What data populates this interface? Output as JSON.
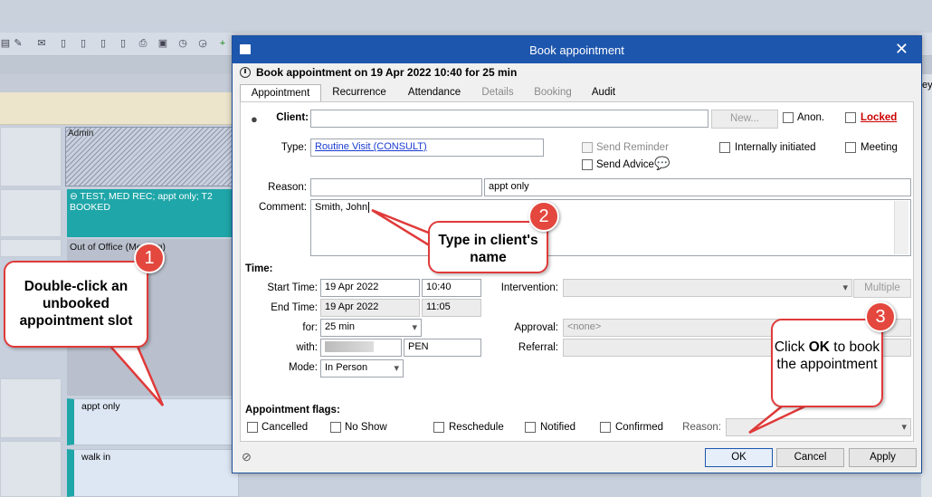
{
  "background": {
    "admin_label": "Admin",
    "teal_slot": "TEST, MED REC; appt only; T2 BOOKED",
    "ooo_slot": "Out of Office (Meeting)",
    "slot1": "appt only",
    "slot2": "walk in",
    "edge_text": "ey",
    "toolbar_icons": [
      "clipboard-icon",
      "tools-icon",
      "envelope-icon",
      "doc-icon",
      "doc-icon",
      "doc-icon",
      "doc-icon",
      "printer-icon",
      "sc-icon",
      "clock-icon",
      "clock-check-icon",
      "add-icon"
    ]
  },
  "dialog": {
    "title": "Book appointment",
    "heading": "Book appointment on 19 Apr 2022 10:40 for 25 min",
    "tabs": [
      {
        "label": "Appointment",
        "state": "active"
      },
      {
        "label": "Recurrence",
        "state": "enabled"
      },
      {
        "label": "Attendance",
        "state": "enabled"
      },
      {
        "label": "Details",
        "state": "disabled"
      },
      {
        "label": "Booking",
        "state": "disabled"
      },
      {
        "label": "Audit",
        "state": "enabled"
      }
    ],
    "client": {
      "label": "Client:",
      "value": "",
      "new_button": "New...",
      "anon": "Anon.",
      "locked": "Locked"
    },
    "type": {
      "label": "Type:",
      "value": "Routine Visit (CONSULT)"
    },
    "send_reminder": "Send Reminder",
    "internally_initiated": "Internally initiated",
    "meeting": "Meeting",
    "send_advice": "Send Advice",
    "reason": {
      "label": "Reason:",
      "code": "",
      "text": "appt only"
    },
    "comment": {
      "label": "Comment:",
      "value": "Smith, John"
    },
    "time": {
      "section": "Time:",
      "start_label": "Start Time:",
      "start_date": "19 Apr 2022",
      "start_time": "10:40",
      "end_label": "End Time:",
      "end_date": "19 Apr 2022",
      "end_time": "11:05",
      "for_label": "for:",
      "duration": "25 min",
      "with_label": "with:",
      "with_code": "PEN",
      "mode_label": "Mode:",
      "mode": "In Person"
    },
    "intervention_label": "Intervention:",
    "multiple_button": "Multiple",
    "approval_label": "Approval:",
    "approval_value": "<none>",
    "referral_label": "Referral:",
    "flags": {
      "section": "Appointment flags:",
      "items": [
        "Cancelled",
        "No Show",
        "Reschedule",
        "Notified",
        "Confirmed"
      ],
      "reason_label": "Reason:"
    },
    "buttons": {
      "ok": "OK",
      "cancel": "Cancel",
      "apply": "Apply"
    }
  },
  "callouts": [
    {
      "number": "1",
      "text": "Double-click an unbooked appointment slot"
    },
    {
      "number": "2",
      "text": "Type in client's name"
    },
    {
      "number": "3",
      "text_pre": "Click ",
      "text_bold": "OK",
      "text_post": " to book the appointment"
    }
  ],
  "colors": {
    "accent": "#1d56ad",
    "callout": "#e03a3a",
    "teal": "#1fa6a8",
    "locked": "#cc0000"
  }
}
